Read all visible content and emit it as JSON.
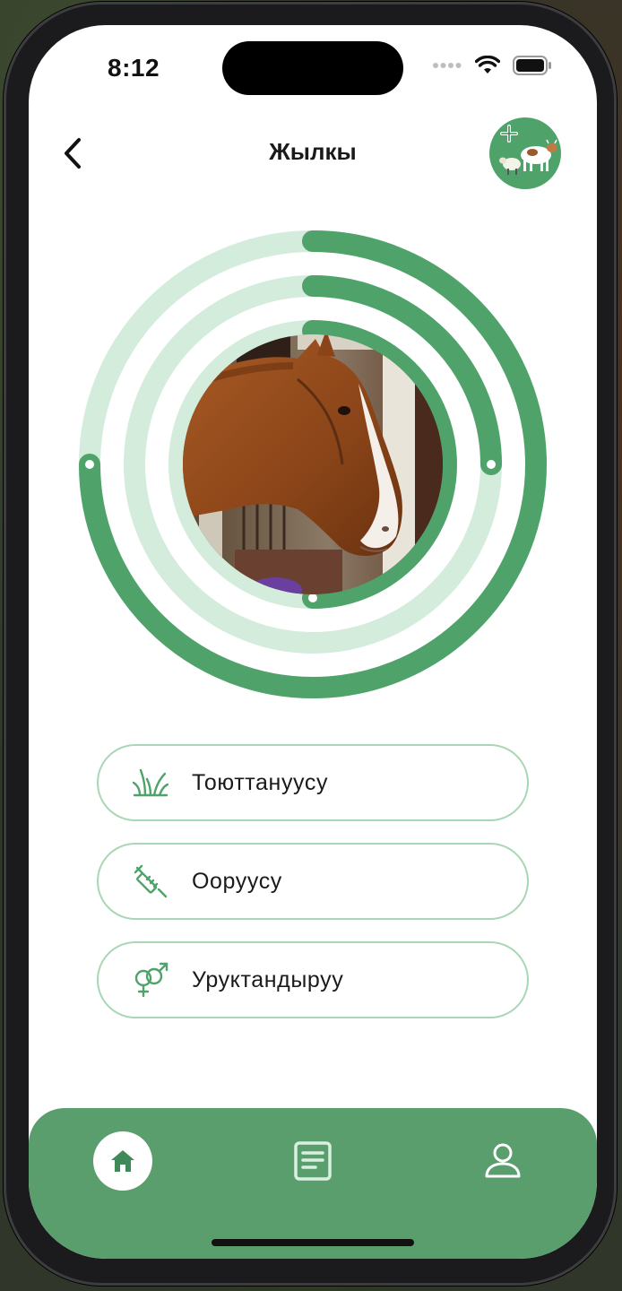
{
  "status_bar": {
    "time": "8:12"
  },
  "header": {
    "title": "Жылкы",
    "back_icon": "chevron-left-icon",
    "add_animal_icon": "add-livestock-icon"
  },
  "progress_rings": {
    "outer": 0.75,
    "middle": 0.25,
    "inner": 0.5,
    "color": "#4fa36a",
    "track_color": "#d4ecdc",
    "image_subject": "horse"
  },
  "menu": [
    {
      "icon": "grass-icon",
      "label": "Тоюттануусу"
    },
    {
      "icon": "syringe-icon",
      "label": "Ооруусу"
    },
    {
      "icon": "gender-icon",
      "label": "Уруктандыруу"
    }
  ],
  "bottom_nav": [
    {
      "icon": "home-icon",
      "active": true
    },
    {
      "icon": "document-icon",
      "active": false
    },
    {
      "icon": "profile-icon",
      "active": false
    }
  ],
  "colors": {
    "accent": "#4fa36a",
    "nav_bg": "#5a9e6e",
    "button_border": "#a9d6b5"
  }
}
